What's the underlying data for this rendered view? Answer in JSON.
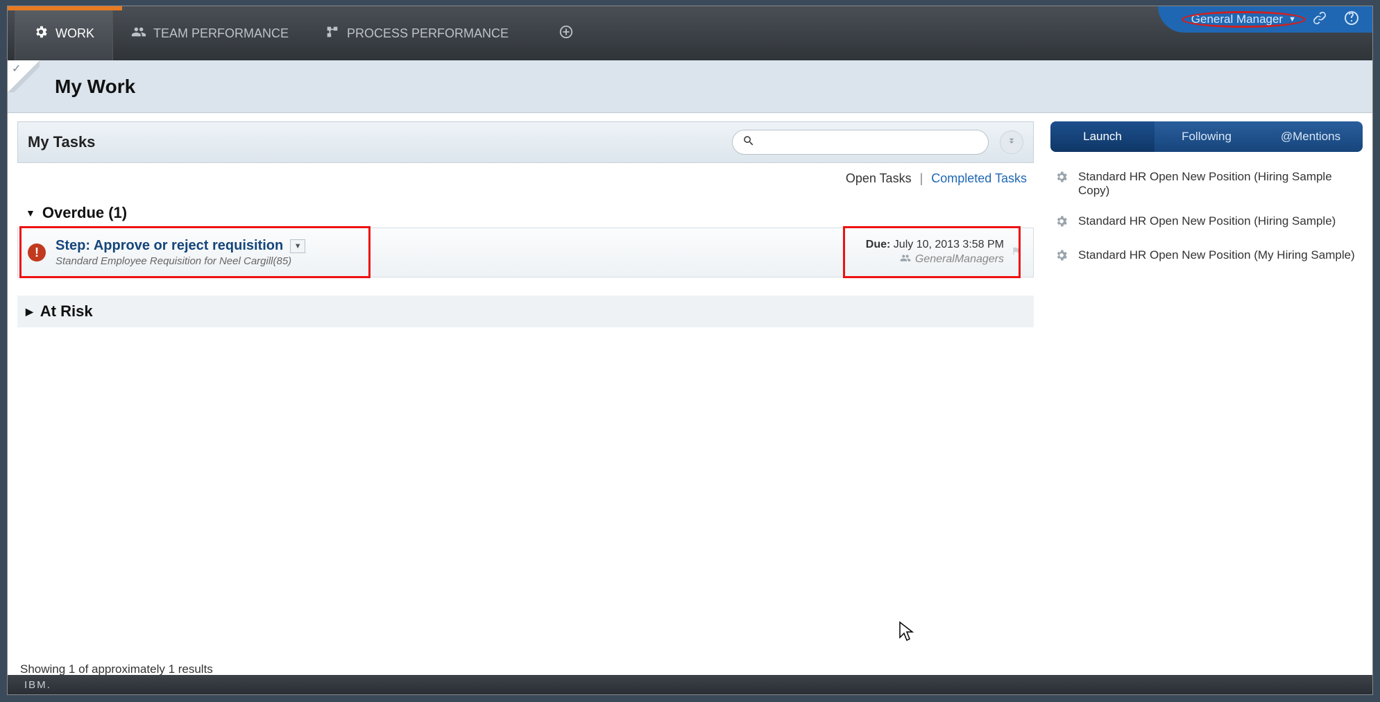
{
  "header": {
    "user_label": "General Manager"
  },
  "nav": {
    "work": "WORK",
    "team_perf": "TEAM PERFORMANCE",
    "process_perf": "PROCESS PERFORMANCE"
  },
  "page": {
    "title": "My Work"
  },
  "mytasks": {
    "title": "My Tasks",
    "search_placeholder": ""
  },
  "filters": {
    "open": "Open Tasks",
    "sep": "|",
    "completed": "Completed Tasks"
  },
  "sections": {
    "overdue_label": "Overdue (1)",
    "atrisk_label": "At Risk"
  },
  "task": {
    "title": "Step: Approve or reject requisition",
    "subtitle": "Standard Employee Requisition for Neel Cargill(85)",
    "due_label": "Due:",
    "due_value": " July 10, 2013 3:58 PM",
    "group": "GeneralManagers"
  },
  "results": {
    "line": "Showing 1 of approximately 1 results"
  },
  "right_tabs": {
    "launch": "Launch",
    "following": "Following",
    "mentions": "@Mentions"
  },
  "launch_items": [
    "Standard HR Open New Position (Hiring Sample Copy)",
    "Standard HR Open New Position (Hiring Sample)",
    "Standard HR Open New Position (My Hiring Sample)"
  ],
  "footer": {
    "brand": "IBM."
  }
}
